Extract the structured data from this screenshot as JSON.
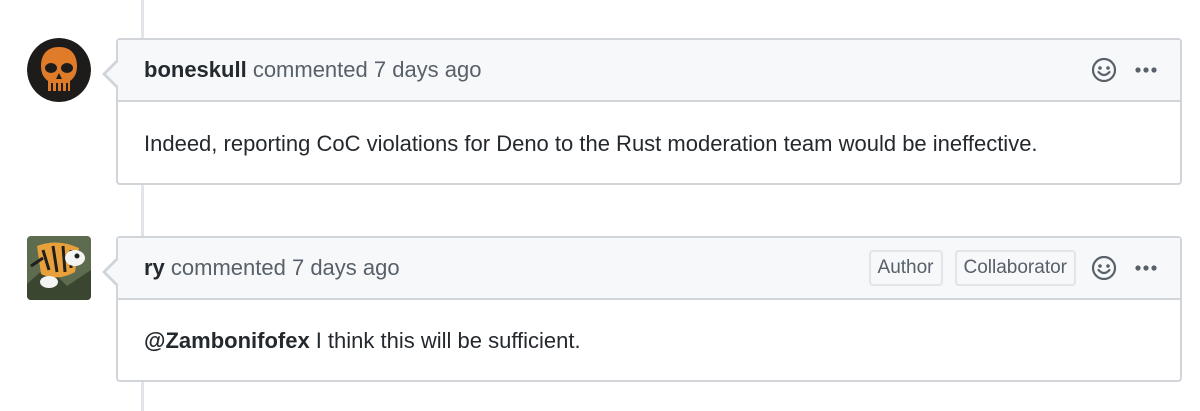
{
  "comments": [
    {
      "author": "boneskull",
      "action": "commented 7 days ago",
      "badges": [],
      "body": "Indeed, reporting CoC violations for Deno to the Rust moderation team would be ineffective.",
      "avatar_color": "#e07b2a",
      "icons": [
        "smiley-icon",
        "kebab-horizontal-icon"
      ]
    },
    {
      "author": "ry",
      "action": "commented 7 days ago",
      "badges": [
        "Author",
        "Collaborator"
      ],
      "mention": "@Zambonifofex",
      "body": "I think this will be sufficient.",
      "icons": [
        "smiley-icon",
        "kebab-horizontal-icon"
      ]
    }
  ],
  "colors": {
    "border": "#d1d5da",
    "header_bg": "#f6f8fa",
    "muted_text": "#586069",
    "text": "#24292e"
  }
}
